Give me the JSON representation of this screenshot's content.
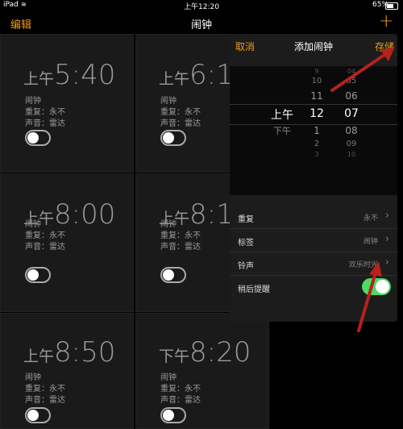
{
  "status": {
    "carrier": "iPad",
    "wifi_icon": "wifi-icon",
    "time": "上午12:20",
    "battery": "65%"
  },
  "nav": {
    "edit": "编辑",
    "title": "闹钟",
    "add_icon": "+"
  },
  "alarms": [
    {
      "ampm": "上午",
      "time": "5:40",
      "label": "闹钟",
      "repeat": "重复：永不",
      "sound": "声音：雷达",
      "enabled": false
    },
    {
      "ampm": "上午",
      "time": "6:1",
      "label": "闹钟",
      "repeat": "重复：永不",
      "sound": "声音：雷达",
      "enabled": false
    },
    {
      "ampm": "上午",
      "time": "8:00",
      "label": "闹钟",
      "repeat": "重复：永不",
      "sound": "声音：雷达",
      "enabled": false
    },
    {
      "ampm": "上午",
      "time": "8:1",
      "label": "闹钟",
      "repeat": "重复：永不",
      "sound": "声音：雷达",
      "enabled": false
    },
    {
      "ampm": "上午",
      "time": "8:50",
      "label": "闹钟",
      "repeat": "重复：永不",
      "sound": "声音：雷达",
      "enabled": false
    },
    {
      "ampm": "下午",
      "time": "8:20",
      "label": "闹钟",
      "repeat": "重复：永不",
      "sound": "声音：雷达",
      "enabled": false
    }
  ],
  "popover": {
    "cancel": "取消",
    "title": "添加闹钟",
    "save": "存储",
    "picker": {
      "ampm": [
        "上午",
        "下午"
      ],
      "hours": [
        "9",
        "10",
        "11",
        "12",
        "1",
        "2",
        "3"
      ],
      "minutes": [
        "04",
        "05",
        "06",
        "07",
        "08",
        "09",
        "10"
      ],
      "selected": {
        "ampm": "上午",
        "hour": "12",
        "minute": "07"
      }
    },
    "rows": [
      {
        "label": "重复",
        "value": "永不"
      },
      {
        "label": "标签",
        "value": "闹钟"
      },
      {
        "label": "铃声",
        "value": "欢乐时光"
      },
      {
        "label": "稍后提醒",
        "toggle": true
      }
    ]
  },
  "colors": {
    "accent": "#f09a1e",
    "toggle_on": "#4cd964",
    "arrow": "#b5221c"
  }
}
